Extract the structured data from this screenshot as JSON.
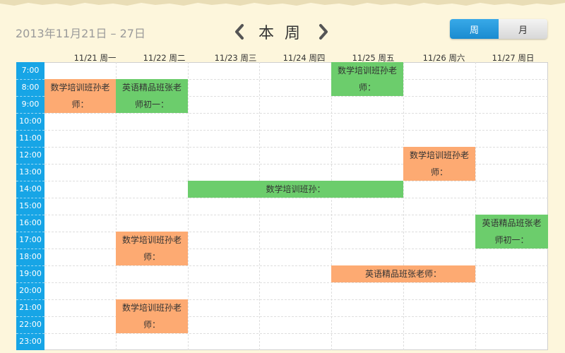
{
  "header": {
    "date_range": "2013年11月21日 – 27日",
    "title": "本 周",
    "prev_icon": "chevron-left-icon",
    "next_icon": "chevron-right-icon",
    "view_week_label": "周",
    "view_month_label": "月"
  },
  "days": [
    "11/21 周一",
    "11/22 周二",
    "11/23 周三",
    "11/24 周四",
    "11/25 周五",
    "11/26 周六",
    "11/27 周日"
  ],
  "hours": [
    "7:00",
    "8:00",
    "9:00",
    "10:00",
    "11:00",
    "12:00",
    "13:00",
    "14:00",
    "15:00",
    "16:00",
    "17:00",
    "18:00",
    "19:00",
    "20:00",
    "21:00",
    "22:00",
    "23:00"
  ],
  "colors": {
    "time_column": "#17a5e6",
    "event_green": "#6ccd6c",
    "event_orange": "#fdaa72",
    "view_active": "#1a8bd0"
  },
  "events": [
    {
      "text": "数学培训班孙老师：",
      "color": "green"
    },
    {
      "text": "数学培训班孙老师：",
      "color": "orange"
    },
    {
      "text": "英语精品班张老师初一：",
      "color": "green"
    },
    {
      "text": "数学培训班孙老师：",
      "color": "orange"
    },
    {
      "text": "数学培训班孙：",
      "color": "green"
    },
    {
      "text": "英语精品班张老师初一：",
      "color": "green"
    },
    {
      "text": "数学培训班孙老师：",
      "color": "orange"
    },
    {
      "text": "英语精品班张老师：",
      "color": "orange"
    },
    {
      "text": "数学培训班孙老师：",
      "color": "orange"
    }
  ]
}
